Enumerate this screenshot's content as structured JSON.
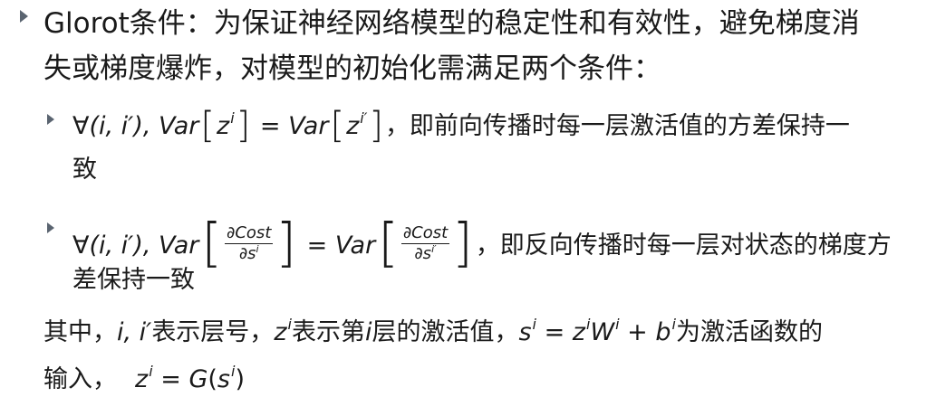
{
  "item1": {
    "line1": "Glorot条件：为保证神经网络模型的稳定性和有效性，避免梯度消",
    "line2": "失或梯度爆炸，对模型的初始化需满足两个条件："
  },
  "sub1": {
    "forall": "∀",
    "args": "(i, i′), ",
    "var_left": "Var",
    "z": "z",
    "sup_i": "i",
    "eq": " = ",
    "var_right": "Var",
    "sup_ip": "i′",
    "text": "，即前向传播时每一层激活值的方差保持一",
    "text_cont": "致"
  },
  "sub2": {
    "forall": "∀",
    "args": "(i, i′), ",
    "var_left": "Var",
    "num": "∂Cost",
    "den": "∂s",
    "sup_i": "i",
    "eq": " = ",
    "var_right": "Var",
    "sup_ip": "i′",
    "text": "，即反向传播时每一层对状态的梯度方",
    "text_cont": "差保持一致"
  },
  "para": {
    "p1": "其中，",
    "layers": "i, i′",
    "p2": "表示层号，",
    "z": "z",
    "sup_i": "i",
    "p3": "表示第",
    "i_var": "i",
    "p4": "层的激活值，",
    "s": "s",
    "eq": " = ",
    "W": "W",
    "plus": " + ",
    "b": "b",
    "p5": "为激活函数的",
    "p6": "输入，",
    "eq2_G": "G",
    "lp": "(",
    "rp": ")"
  }
}
